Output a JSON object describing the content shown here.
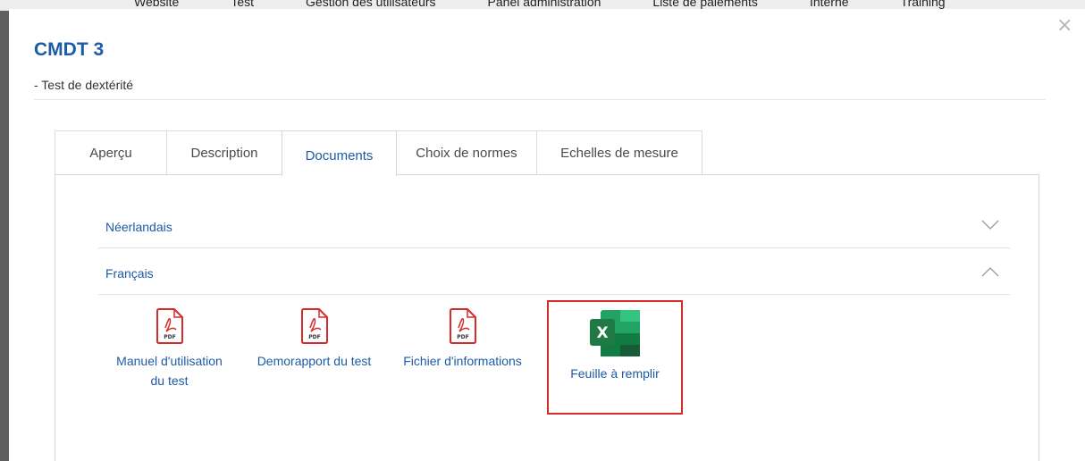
{
  "background_nav": {
    "items": [
      "Website",
      "Test",
      "Gestion des utilisateurs",
      "Panel administration",
      "Liste de paiements",
      "Interne",
      "Training"
    ]
  },
  "modal": {
    "title": "CMDT 3",
    "subtitle": "- Test de dextérité",
    "close_symbol": "×"
  },
  "tabs": [
    {
      "label": "Aperçu",
      "active": false
    },
    {
      "label": "Description",
      "active": false
    },
    {
      "label": "Documents",
      "active": true
    },
    {
      "label": "Choix de normes",
      "active": false
    },
    {
      "label": "Echelles de mesure",
      "active": false
    }
  ],
  "accordion": [
    {
      "label": "Néerlandais",
      "expanded": false
    },
    {
      "label": "Français",
      "expanded": true
    }
  ],
  "documents": [
    {
      "label": "Manuel d'utilisation du test",
      "type": "pdf",
      "icon": "pdf-icon"
    },
    {
      "label": "Demorapport du test",
      "type": "pdf",
      "icon": "pdf-icon"
    },
    {
      "label": "Fichier d'informations",
      "type": "pdf",
      "icon": "pdf-icon"
    },
    {
      "label": "Feuille à remplir",
      "type": "excel",
      "icon": "excel-icon",
      "highlighted": true
    }
  ],
  "colors": {
    "accent": "#1c5ba6",
    "pdf_red": "#d52b2b",
    "excel_green": "#1f7a45",
    "highlight_border": "#d52b2b"
  }
}
